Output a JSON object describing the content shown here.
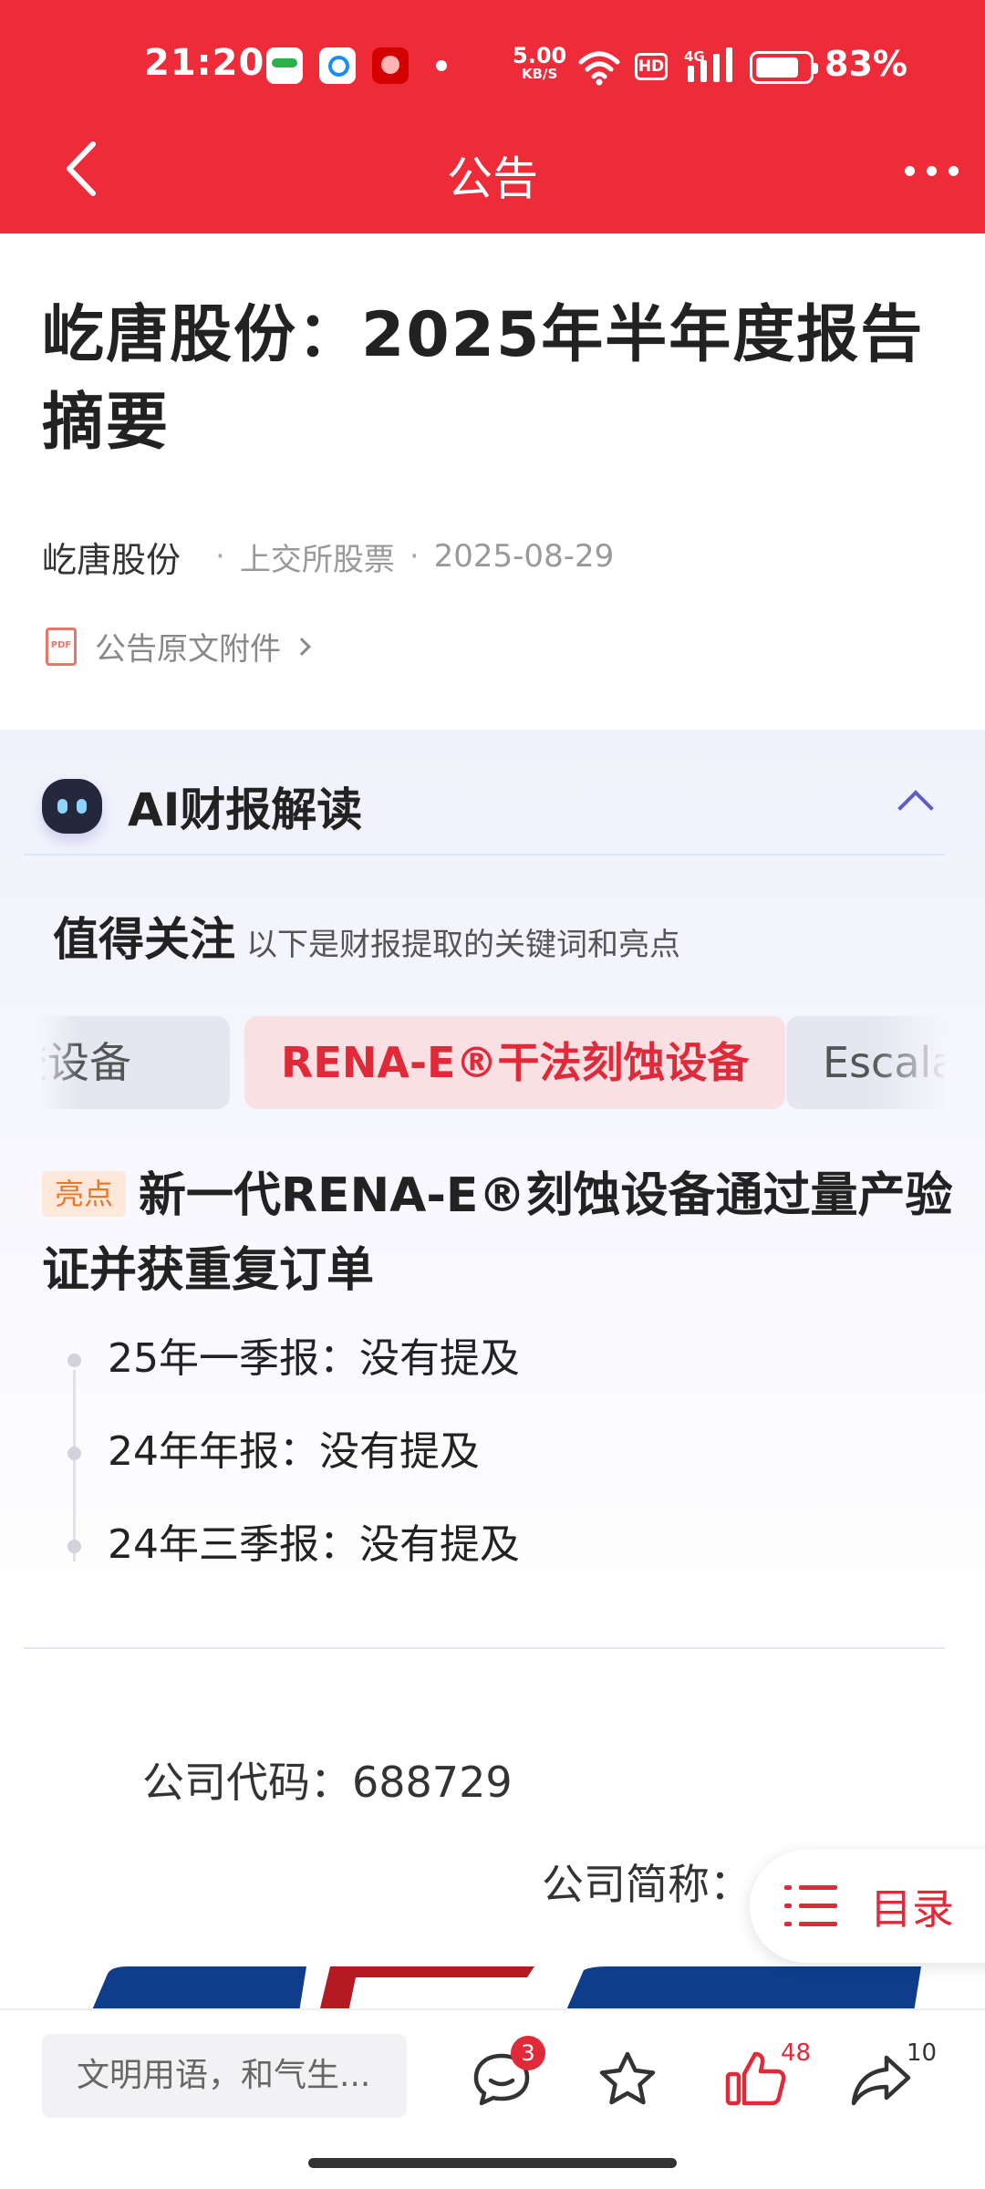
{
  "status_bar": {
    "time": "21:20",
    "net_speed": "5.00",
    "net_unit": "KB/S",
    "hd_label": "HD",
    "signal_label": "4G",
    "battery_level": 0.83,
    "battery_percent": "83%"
  },
  "header": {
    "title": "公告",
    "back_icon": "chevron-left-icon",
    "more_icon": "more-dots-icon"
  },
  "article": {
    "title": "屹唐股份：2025年半年度报告摘要",
    "author": "屹唐股份",
    "sep": "·",
    "category": "上交所股票",
    "date": "2025-08-29",
    "attachment_label": "公告原文附件",
    "pdf_icon_text": "PDF"
  },
  "ai_section": {
    "title": "AI财报解读",
    "focus_title": "值得关注",
    "focus_subtitle": "以下是财报提取的关键词和亮点",
    "chips": [
      "胶设备",
      "RENA-E®干法刻蚀设备",
      "Escala"
    ],
    "highlight_tag": "亮点",
    "highlight_text": "新一代RENA-E®刻蚀设备通过量产验证并获重复订单",
    "timeline": [
      "25年一季报：没有提及",
      "24年年报：没有提及",
      "24年三季报：没有提及"
    ]
  },
  "document": {
    "company_code": "公司代码：688729",
    "company_short_name": "公司简称："
  },
  "toc_button": {
    "label": "目录"
  },
  "bottom_bar": {
    "comment_placeholder": "文明用语，和气生...",
    "comment_count": "3",
    "like_count": "48",
    "share_count": "10"
  },
  "colors": {
    "brand_red": "#ee2b39",
    "accent_red": "#e02a3a",
    "ai_purple": "#5b5fc7",
    "highlight_orange": "#e8772e"
  }
}
